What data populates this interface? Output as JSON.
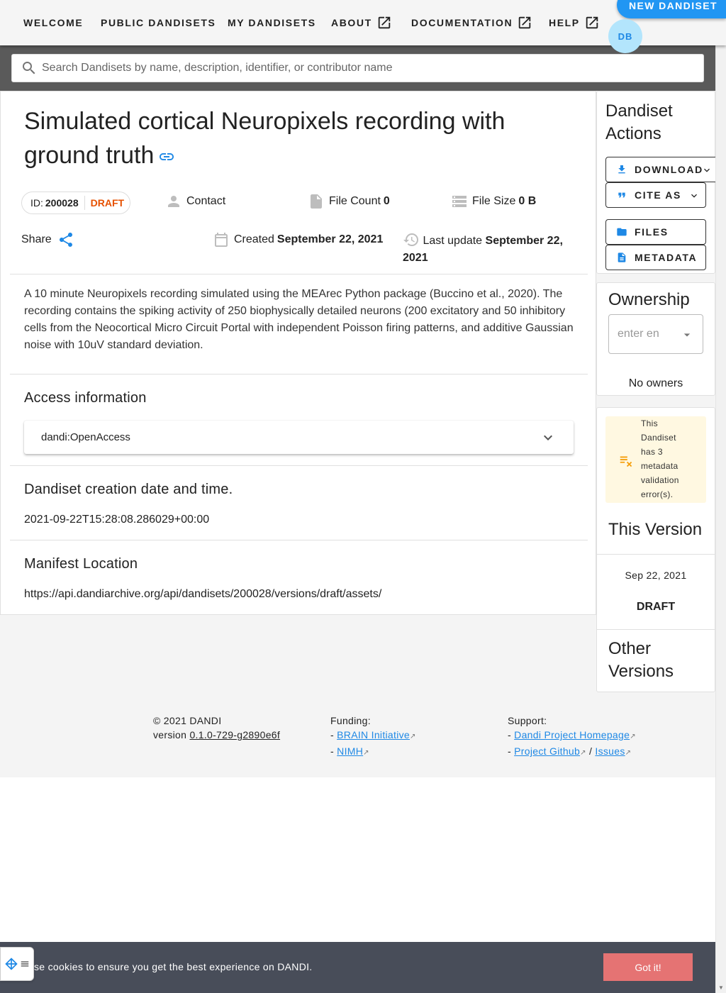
{
  "nav": {
    "welcome": "WELCOME",
    "public": "PUBLIC DANDISETS",
    "mine": "MY DANDISETS",
    "about": "ABOUT",
    "docs": "DOCUMENTATION",
    "help": "HELP",
    "new_dandiset": "NEW DANDISET",
    "avatar_initials": "DB"
  },
  "search": {
    "placeholder": "Search Dandisets by name, description, identifier, or contributor name"
  },
  "dandiset": {
    "title": "Simulated cortical Neuropixels recording with ground truth",
    "id_label": "ID:",
    "id": "200028",
    "status": "DRAFT",
    "contact_label": "Contact",
    "file_count_label": "File Count",
    "file_count": "0",
    "file_size_label": "File Size",
    "file_size": "0 B",
    "share_label": "Share",
    "created_label": "Created",
    "created": "September 22, 2021",
    "updated_label": "Last update",
    "updated": "September 22, 2021",
    "description": "A 10 minute Neuropixels recording simulated using the MEArec Python package (Buccino et al., 2020). The recording contains the spiking activity of 250 biophysically detailed neurons (200 excitatory and 50 inhibitory cells from the Neocortical Micro Circuit Portal with independent Poisson firing patterns, and additive Gaussian noise with 10uV standard deviation."
  },
  "access": {
    "heading": "Access information",
    "value": "dandi:OpenAccess"
  },
  "creation": {
    "heading": "Dandiset creation date and time.",
    "value": "2021-09-22T15:28:08.286029+00:00"
  },
  "manifest": {
    "heading": "Manifest Location",
    "value": "https://api.dandiarchive.org/api/dandisets/200028/versions/draft/assets/"
  },
  "actions": {
    "heading": "Dandiset Actions",
    "download": "DOWNLOAD",
    "cite": "CITE AS",
    "files": "FILES",
    "metadata": "METADATA"
  },
  "ownership": {
    "heading": "Ownership",
    "placeholder": "enter en",
    "empty": "No owners"
  },
  "validation": {
    "message": "This Dandiset has 3 metadata validation error(s)."
  },
  "versions": {
    "this_heading": "This Version",
    "date": "Sep 22, 2021",
    "name": "DRAFT",
    "other_heading": "Other Versions"
  },
  "footer": {
    "copyright": "© 2021 DANDI",
    "version_label": "version",
    "version": "0.1.0-729-g2890e6f",
    "funding_label": "Funding:",
    "brain": "BRAIN Initiative",
    "nimh": "NIMH",
    "support_label": "Support:",
    "homepage": "Dandi Project Homepage",
    "github": "Project Github",
    "issues": "Issues",
    "dash": "-",
    "slash": "/"
  },
  "cookie": {
    "message": "se cookies to ensure you get the best experience on DANDI.",
    "button": "Got it!"
  },
  "colors": {
    "accent": "#2196f3",
    "draft": "#e65100",
    "cookie_bg": "#484d59",
    "cookie_btn": "#e57373",
    "warning_bg": "#fff8e1",
    "warning_icon": "#f59e0b"
  }
}
